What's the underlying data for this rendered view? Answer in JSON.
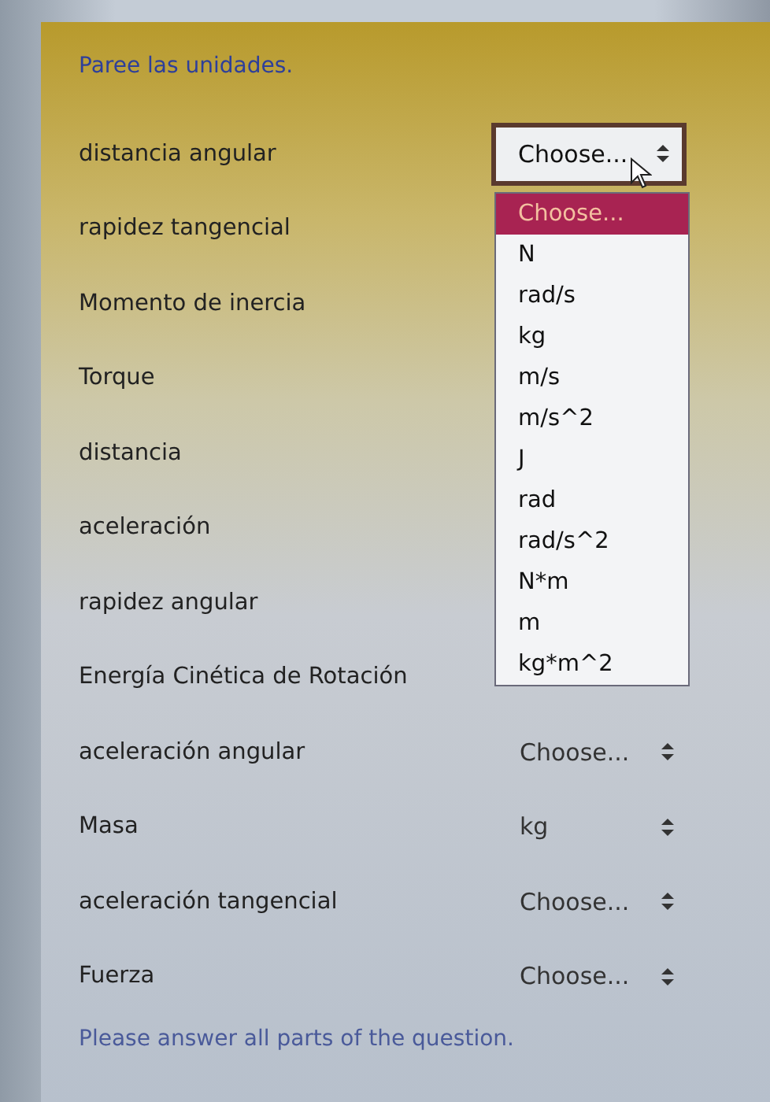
{
  "heading": "Paree las unidades.",
  "rows": [
    {
      "label": "distancia angular",
      "value": "Choose...",
      "expanded": true,
      "options": [
        {
          "label": "Choose...",
          "selected": true
        },
        {
          "label": "N",
          "selected": false
        },
        {
          "label": "rad/s",
          "selected": false
        },
        {
          "label": "kg",
          "selected": false
        },
        {
          "label": "m/s",
          "selected": false
        },
        {
          "label": "m/s^2",
          "selected": false
        },
        {
          "label": "J",
          "selected": false
        },
        {
          "label": "rad",
          "selected": false
        },
        {
          "label": "rad/s^2",
          "selected": false
        },
        {
          "label": "N*m",
          "selected": false
        },
        {
          "label": "m",
          "selected": false
        },
        {
          "label": "kg*m^2",
          "selected": false
        }
      ]
    },
    {
      "label": "rapidez tangencial"
    },
    {
      "label": "Momento de inercia"
    },
    {
      "label": "Torque"
    },
    {
      "label": "distancia"
    },
    {
      "label": "aceleración"
    },
    {
      "label": "rapidez angular"
    },
    {
      "label": "Energía Cinética de Rotación"
    },
    {
      "label": "aceleración angular",
      "value": "Choose...",
      "expanded": false
    },
    {
      "label": "Masa",
      "value": "kg",
      "expanded": false
    },
    {
      "label": "aceleración tangencial",
      "value": "Choose...",
      "expanded": false
    },
    {
      "label": "Fuerza",
      "value": "Choose...",
      "expanded": false
    }
  ],
  "footer": "Please answer all parts of the question."
}
